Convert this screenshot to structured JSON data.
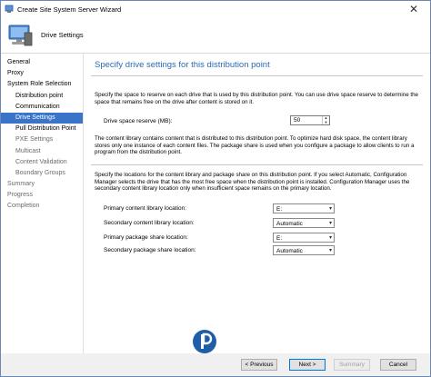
{
  "window": {
    "title": "Create Site System Server Wizard"
  },
  "banner": {
    "title": "Drive Settings"
  },
  "nav": {
    "items": [
      {
        "label": "General",
        "sub": false,
        "state": "normal"
      },
      {
        "label": "Proxy",
        "sub": false,
        "state": "normal"
      },
      {
        "label": "System Role Selection",
        "sub": false,
        "state": "normal"
      },
      {
        "label": "Distribution point",
        "sub": true,
        "state": "normal"
      },
      {
        "label": "Communication",
        "sub": true,
        "state": "normal"
      },
      {
        "label": "Drive Settings",
        "sub": true,
        "state": "active"
      },
      {
        "label": "Pull Distribution Point",
        "sub": true,
        "state": "normal"
      },
      {
        "label": "PXE Settings",
        "sub": true,
        "state": "muted"
      },
      {
        "label": "Multicast",
        "sub": true,
        "state": "muted"
      },
      {
        "label": "Content Validation",
        "sub": true,
        "state": "muted"
      },
      {
        "label": "Boundary Groups",
        "sub": true,
        "state": "muted"
      },
      {
        "label": "Summary",
        "sub": false,
        "state": "muted"
      },
      {
        "label": "Progress",
        "sub": false,
        "state": "muted"
      },
      {
        "label": "Completion",
        "sub": false,
        "state": "muted"
      }
    ]
  },
  "main": {
    "heading": "Specify drive settings for this distribution point",
    "para1": "Specify the space to reserve on each drive that is used by this distribution point. You can use drive space reserve to determine the space that remains free on the drive after content is stored on it.",
    "drive_reserve_label": "Drive space reserve (MB):",
    "drive_reserve_value": "50",
    "para2": "The content library contains content that is distributed to this distribution point. To optimize hard disk space, the content library stores only one instance of each content files. The package share is used when you configure a package to allow clients to run a program from the distribution point.",
    "para3": "Specify the locations for the content library and package share on this distribution point. If you select Automatic, Configuration Manager selects the drive that has the most free space when the distribution point is installed. Configuration Manager uses the secondary content library location only when insufficient space remains on the primary location.",
    "locations": [
      {
        "label": "Primary content library location:",
        "value": "E:"
      },
      {
        "label": "Secondary content library location:",
        "value": "Automatic"
      },
      {
        "label": "Primary package share location:",
        "value": "E:"
      },
      {
        "label": "Secondary package share location:",
        "value": "Automatic"
      }
    ]
  },
  "footer": {
    "previous": "< Previous",
    "next": "Next >",
    "summary": "Summary",
    "cancel": "Cancel"
  },
  "colors": {
    "accent": "#2a6ab5",
    "nav_active": "#3a74c8"
  }
}
